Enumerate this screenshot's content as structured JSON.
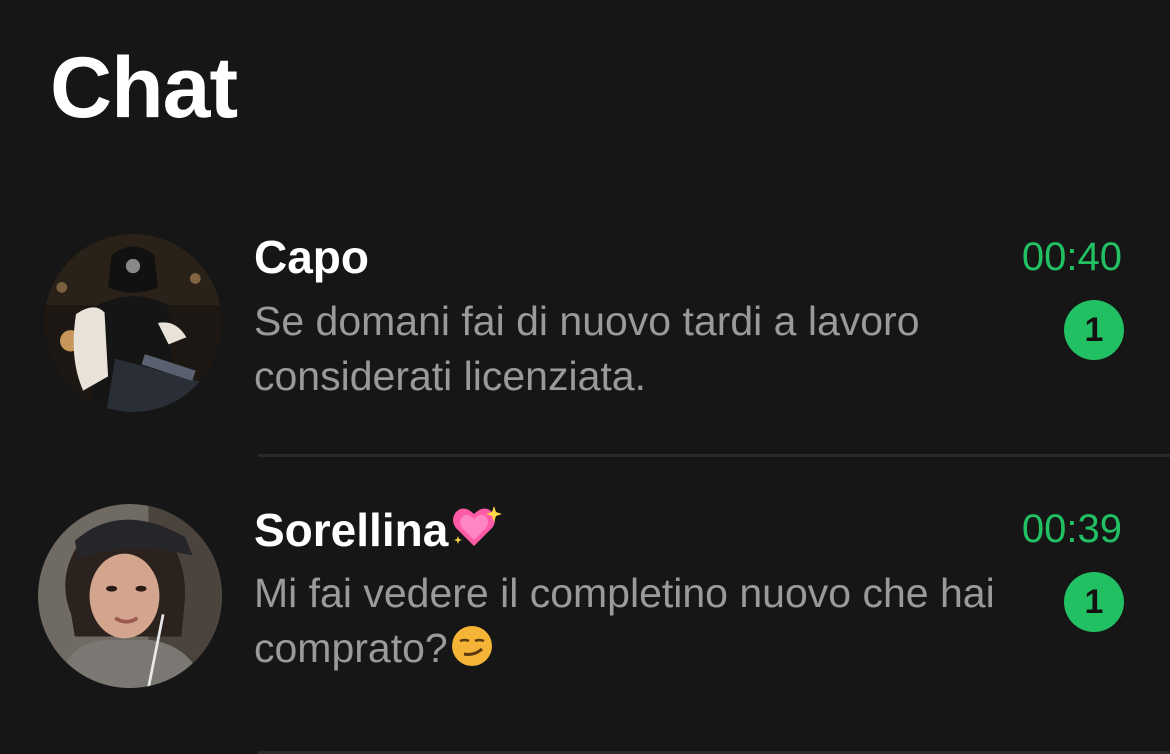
{
  "header": {
    "title": "Chat"
  },
  "chats": [
    {
      "name": "Capo",
      "time": "00:40",
      "preview": "Se domani fai di nuovo tardi a lavoro considerati licenziata.",
      "unread": "1",
      "avatar": "profile-photo-motorcycle-rider"
    },
    {
      "name": "Sorellina",
      "name_emoji": "sparkling-heart",
      "time": "00:39",
      "preview": "Mi fai vedere il completino nuovo che hai comprato?",
      "preview_emoji": "smirking-face",
      "unread": "1",
      "avatar": "profile-photo-girl-with-cap"
    }
  ],
  "colors": {
    "background": "#161616",
    "accent": "#21c063",
    "preview_text": "#9a9a9a",
    "divider": "#2a2a2a"
  }
}
